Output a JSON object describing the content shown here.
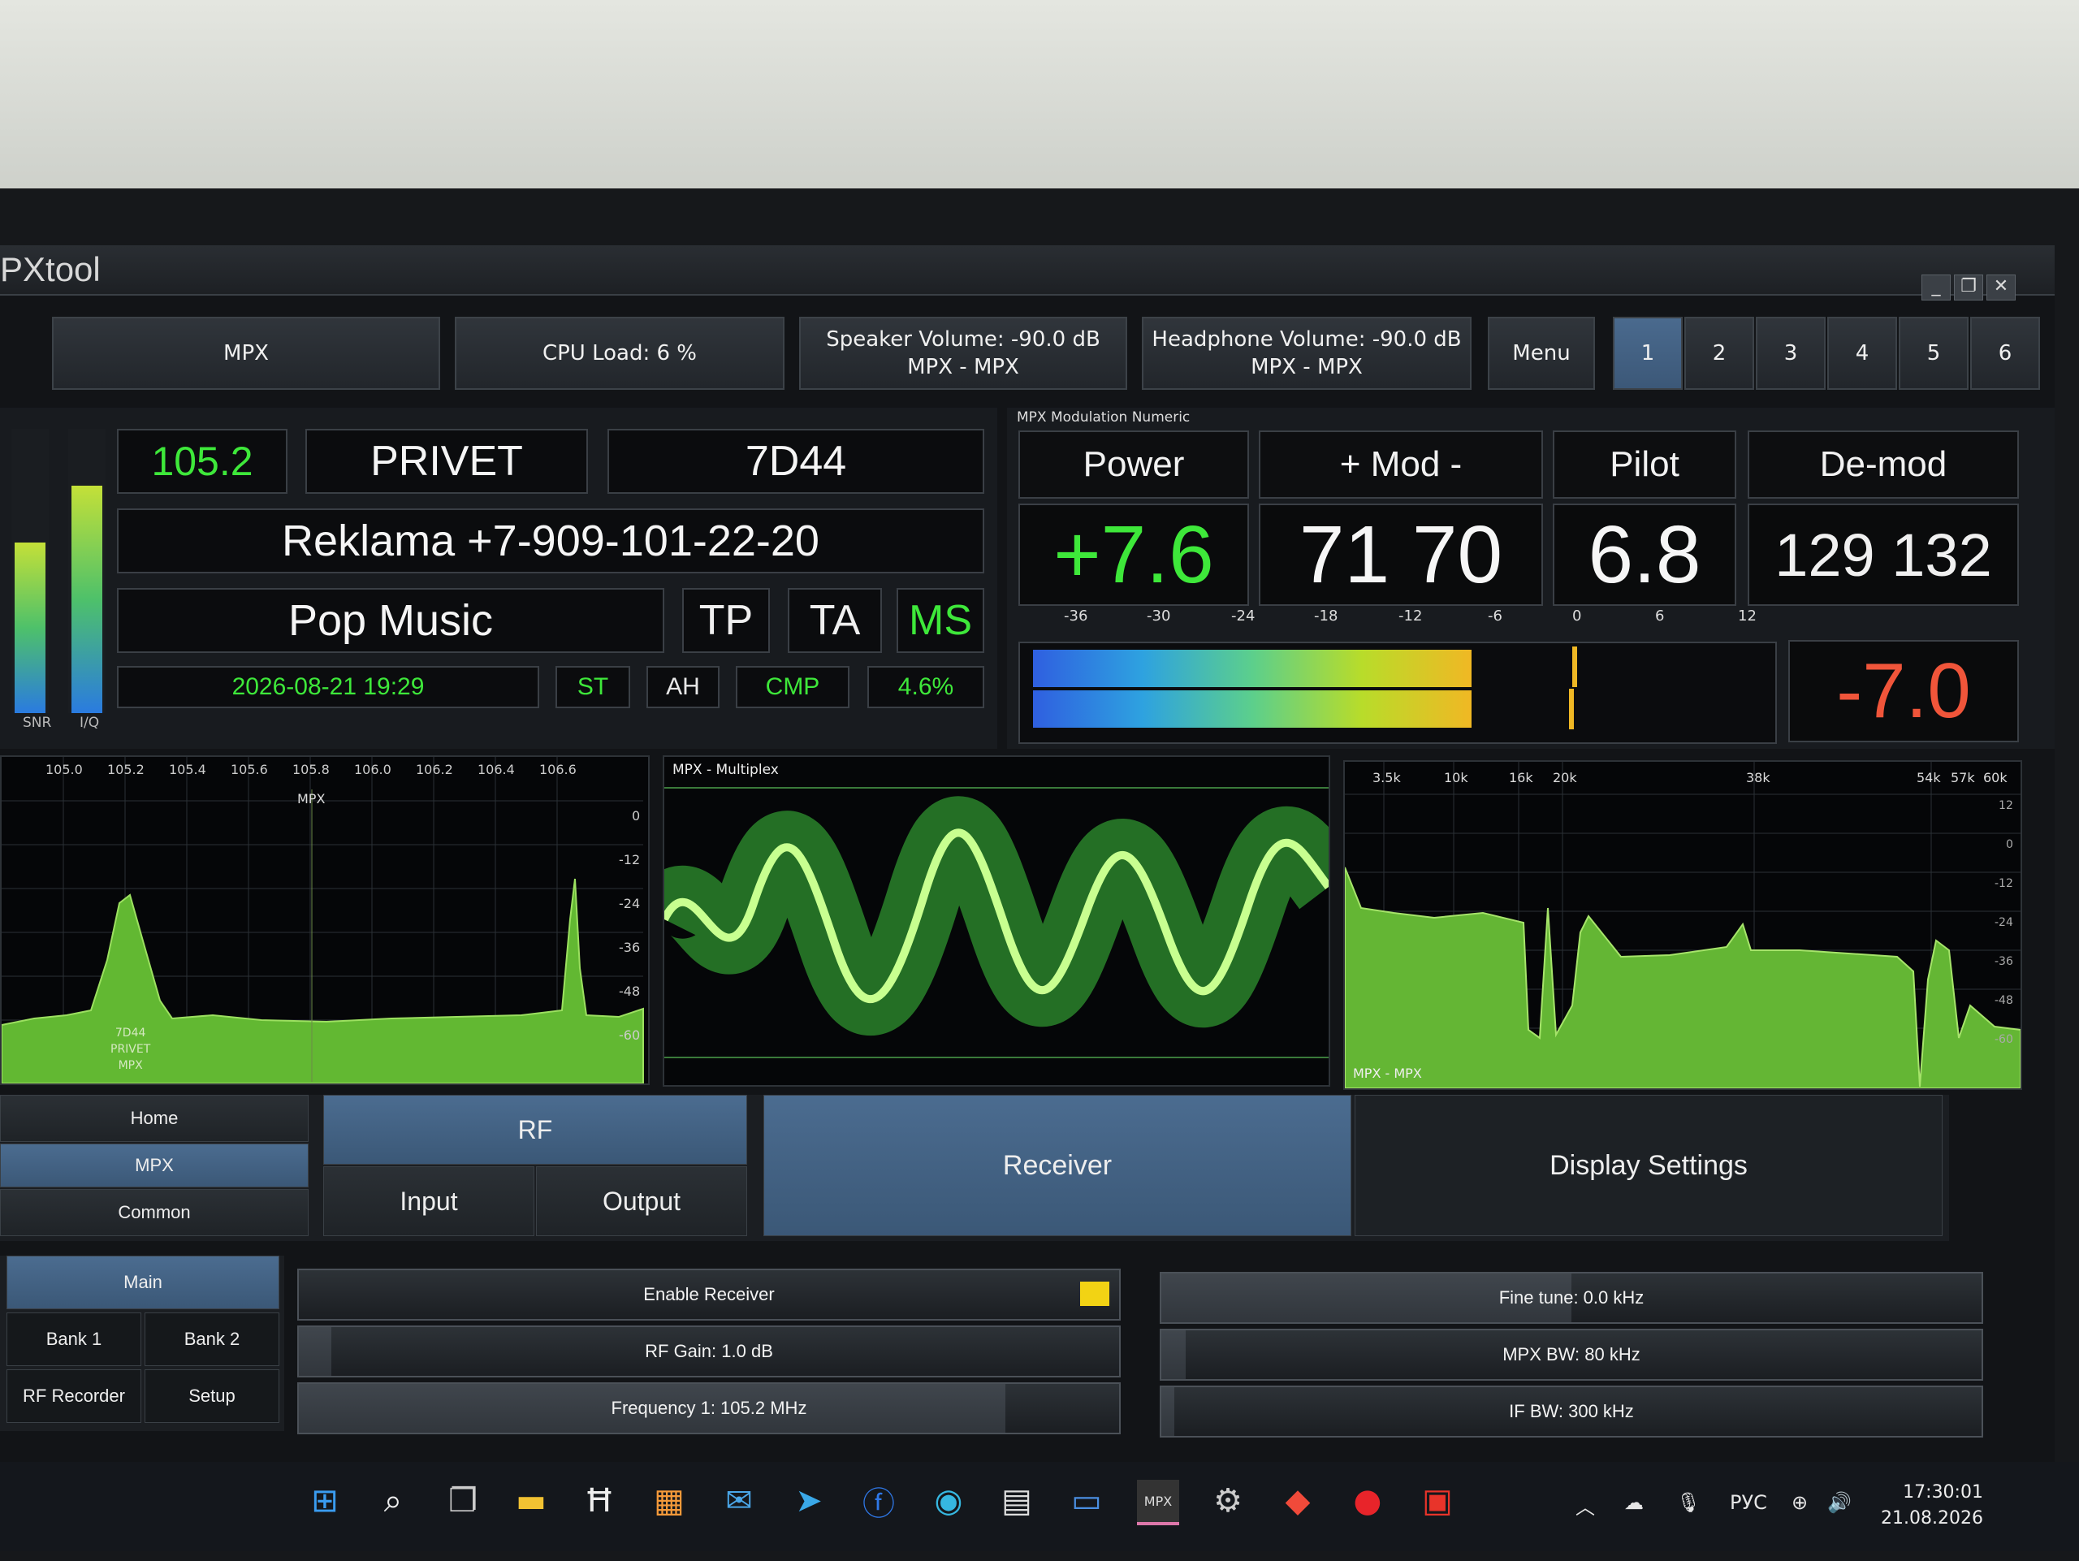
{
  "app": {
    "title": "PXtool"
  },
  "window_buttons": {
    "minimize": "_",
    "restore": "❐",
    "close": "✕"
  },
  "topbar": {
    "mode": "MPX",
    "cpu": "CPU Load: 6 %",
    "speaker_line1": "Speaker Volume: -90.0 dB",
    "speaker_line2": "MPX - MPX",
    "headphone_line1": "Headphone Volume: -90.0 dB",
    "headphone_line2": "MPX - MPX",
    "menu": "Menu",
    "pages": [
      "1",
      "2",
      "3",
      "4",
      "5",
      "6"
    ]
  },
  "rds": {
    "frequency": "105.2",
    "ps": "PRIVET",
    "pi": "7D44",
    "radiotext": "Reklama +7-909-101-22-20",
    "pty": "Pop Music",
    "tp": "TP",
    "ta": "TA",
    "ms": "MS",
    "datetime": "2026-08-21 19:29",
    "st": "ST",
    "ah": "AH",
    "cmp": "CMP",
    "percent": "4.6%",
    "snr_label": "SNR",
    "iq_label": "I/Q",
    "snr_level": 0.6,
    "iq_level": 0.8
  },
  "modulation": {
    "panel_title": "MPX Modulation Numeric",
    "power_label": "Power",
    "power_value": "+7.6",
    "mod_label": "+ Mod -",
    "mod_value": "71 70",
    "pilot_label": "Pilot",
    "pilot_value": "6.8",
    "demod_label": "De-mod",
    "demod_value": "129 132",
    "peak_value": "-7.0",
    "scale": [
      "-36",
      "-30",
      "-24",
      "-18",
      "-12",
      "-6",
      "0",
      "6",
      "12"
    ]
  },
  "spectrum_rf": {
    "freq_ticks": [
      "105.0",
      "105.2",
      "105.4",
      "105.6",
      "105.8",
      "106.0",
      "106.2",
      "106.4",
      "106.6"
    ],
    "db_ticks": [
      "0",
      "-12",
      "-24",
      "-36",
      "-48",
      "-60"
    ],
    "marker": "MPX",
    "station_label": [
      "7D44",
      "PRIVET",
      "MPX"
    ]
  },
  "oscilloscope": {
    "title": "MPX - Multiplex"
  },
  "spectrum_mpx": {
    "freq_ticks": [
      "3.5k",
      "10k",
      "16k",
      "20k",
      "38k",
      "54k",
      "57k",
      "60k"
    ],
    "db_ticks": [
      "12",
      "0",
      "-12",
      "-24",
      "-36",
      "-48",
      "-60"
    ],
    "label": "MPX - MPX"
  },
  "nav": {
    "home": "Home",
    "mpx": "MPX",
    "common": "Common",
    "rf": "RF",
    "input": "Input",
    "output": "Output",
    "receiver": "Receiver",
    "display_settings": "Display Settings"
  },
  "subnav": {
    "main": "Main",
    "bank1": "Bank 1",
    "bank2": "Bank 2",
    "rf_recorder": "RF Recorder",
    "setup": "Setup"
  },
  "controls": {
    "enable_receiver": "Enable Receiver",
    "rf_gain": "RF Gain: 1.0 dB",
    "frequency1": "Frequency 1: 105.2 MHz",
    "fine_tune": "Fine tune: 0.0 kHz",
    "mpx_bw": "MPX BW: 80 kHz",
    "if_bw": "IF BW: 300 kHz",
    "colors": {
      "accent_green": "#3ee83a",
      "enable_indicator": "#f2d314",
      "peak_red": "#f0553a"
    }
  },
  "taskbar": {
    "language": "РУС",
    "time": "17:30:01",
    "date": "21.08.2026"
  }
}
